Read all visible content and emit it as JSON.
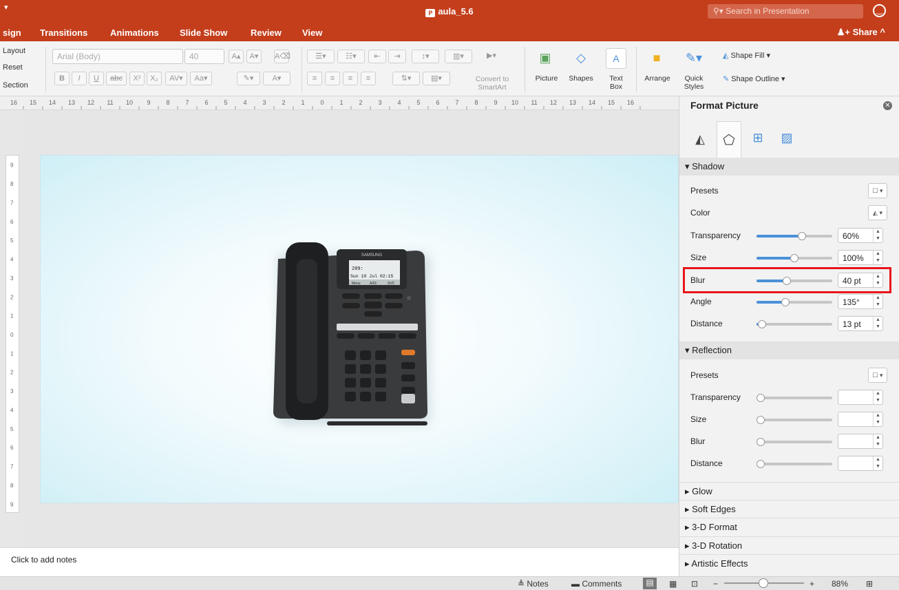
{
  "window": {
    "title": "aula_5.6",
    "search_placeholder": "Search in Presentation"
  },
  "tabs": [
    "sign",
    "Transitions",
    "Animations",
    "Slide Show",
    "Review",
    "View"
  ],
  "share_label": "Share",
  "ribbon": {
    "layout_label": "Layout",
    "reset_label": "Reset",
    "section_label": "Section",
    "font_name": "Arial (Body)",
    "font_size": "40",
    "convert_smartart": "Convert to SmartArt",
    "picture_label": "Picture",
    "shapes_label": "Shapes",
    "textbox_label": "Text Box",
    "arrange_label": "Arrange",
    "quick_styles_label": "Quick Styles",
    "shape_fill_label": "Shape Fill",
    "shape_outline_label": "Shape Outline"
  },
  "ruler_ticks": [
    "16",
    "15",
    "14",
    "13",
    "12",
    "11",
    "10",
    "9",
    "8",
    "7",
    "6",
    "5",
    "4",
    "3",
    "2",
    "1",
    "0",
    "1",
    "2",
    "3",
    "4",
    "5",
    "6",
    "7",
    "8",
    "9",
    "10",
    "11",
    "12",
    "13",
    "14",
    "15",
    "16"
  ],
  "vruler_ticks": [
    "9",
    "8",
    "7",
    "6",
    "5",
    "4",
    "3",
    "2",
    "1",
    "0",
    "1",
    "2",
    "3",
    "4",
    "5",
    "6",
    "7",
    "8",
    "9"
  ],
  "slide": {
    "phone": {
      "brand": "SAMSUNG",
      "screen_line1": "209:",
      "screen_line2": "Sun 10 Jul 02:15",
      "softkeys": [
        "Menu",
        "A/01",
        "SVC"
      ]
    }
  },
  "notes_placeholder": "Click to add notes",
  "panel": {
    "title": "Format Picture",
    "shadow": {
      "heading": "Shadow",
      "presets_label": "Presets",
      "color_label": "Color",
      "transparency_label": "Transparency",
      "transparency_value": "60%",
      "transparency_level": 0.6,
      "size_label": "Size",
      "size_value": "100%",
      "size_level": 0.5,
      "blur_label": "Blur",
      "blur_value": "40 pt",
      "blur_level": 0.4,
      "angle_label": "Angle",
      "angle_value": "135°",
      "angle_level": 0.38,
      "distance_label": "Distance",
      "distance_value": "13 pt",
      "distance_level": 0.07
    },
    "reflection": {
      "heading": "Reflection",
      "presets_label": "Presets",
      "transparency_label": "Transparency",
      "size_label": "Size",
      "blur_label": "Blur",
      "distance_label": "Distance"
    },
    "collapsed_sections": [
      "Glow",
      "Soft Edges",
      "3-D Format",
      "3-D Rotation",
      "Artistic Effects"
    ]
  },
  "status": {
    "notes_label": "Notes",
    "comments_label": "Comments",
    "zoom": "88%"
  },
  "colors": {
    "accent": "#c43e1c",
    "slider": "#4a90d9",
    "highlight": "#e8141a"
  }
}
